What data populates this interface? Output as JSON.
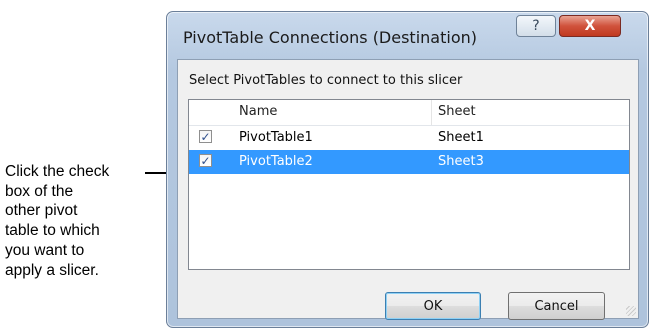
{
  "annotation": {
    "lines": [
      "Click the check",
      "box of the",
      "other pivot",
      "table to which",
      "you want to",
      "apply a slicer."
    ]
  },
  "dialog": {
    "title": "PivotTable Connections (Destination)",
    "help_glyph": "?",
    "close_glyph": "X",
    "prompt": "Select PivotTables to connect to this slicer",
    "columns": {
      "name": "Name",
      "sheet": "Sheet"
    },
    "rows": [
      {
        "name": "PivotTable1",
        "sheet": "Sheet1",
        "checked": true,
        "check_glyph": "✓",
        "selected": false
      },
      {
        "name": "PivotTable2",
        "sheet": "Sheet3",
        "checked": true,
        "check_glyph": "✓",
        "selected": true
      }
    ],
    "ok_label": "OK",
    "cancel_label": "Cancel"
  },
  "colors": {
    "selection": "#3399ff",
    "close_button": "#c0391f"
  }
}
